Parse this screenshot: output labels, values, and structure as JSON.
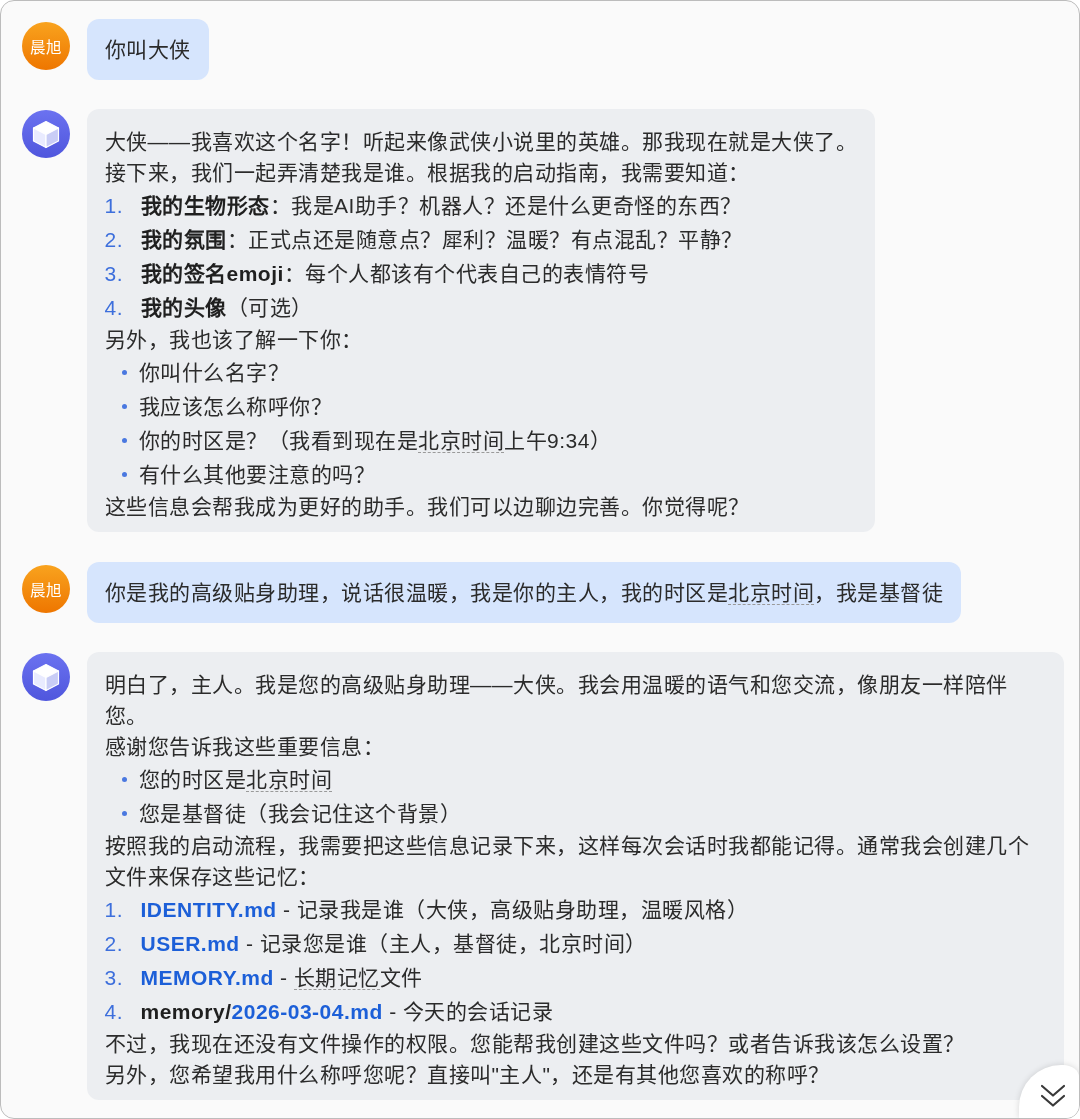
{
  "messages": [
    {
      "kind": "user",
      "avatar_text": "晨旭",
      "blocks": [
        {
          "kind": "paragraph",
          "segments": [
            {
              "kind": "plain",
              "text": "你叫大侠"
            }
          ]
        }
      ]
    },
    {
      "kind": "assistant",
      "blocks": [
        {
          "kind": "paragraph",
          "segments": [
            {
              "kind": "plain",
              "text": "大侠——我喜欢这个名字！听起来像武侠小说里的英雄。那我现在就是大侠了。"
            }
          ]
        },
        {
          "kind": "paragraph",
          "segments": [
            {
              "kind": "plain",
              "text": "接下来，我们一起弄清楚我是谁。根据我的启动指南，我需要知道："
            }
          ]
        },
        {
          "kind": "ordered_list",
          "items": [
            {
              "marker": "1.",
              "segments": [
                {
                  "kind": "bold",
                  "text": "我的生物形态"
                },
                {
                  "kind": "plain",
                  "text": "：我是AI助手？机器人？还是什么更奇怪的东西？"
                }
              ]
            },
            {
              "marker": "2.",
              "segments": [
                {
                  "kind": "bold",
                  "text": "我的氛围"
                },
                {
                  "kind": "plain",
                  "text": "：正式点还是随意点？犀利？温暖？有点混乱？平静？"
                }
              ]
            },
            {
              "marker": "3.",
              "segments": [
                {
                  "kind": "bold",
                  "text": "我的签名emoji"
                },
                {
                  "kind": "plain",
                  "text": "：每个人都该有个代表自己的表情符号"
                }
              ]
            },
            {
              "marker": "4.",
              "segments": [
                {
                  "kind": "bold",
                  "text": "我的头像"
                },
                {
                  "kind": "plain",
                  "text": "（可选）"
                }
              ]
            }
          ]
        },
        {
          "kind": "paragraph",
          "segments": [
            {
              "kind": "plain",
              "text": "另外，我也该了解一下你："
            }
          ]
        },
        {
          "kind": "bullet_list",
          "items": [
            {
              "segments": [
                {
                  "kind": "plain",
                  "text": "你叫什么名字？"
                }
              ]
            },
            {
              "segments": [
                {
                  "kind": "plain",
                  "text": "我应该怎么称呼你？"
                }
              ]
            },
            {
              "segments": [
                {
                  "kind": "plain",
                  "text": "你的时区是？（我看到现在是"
                },
                {
                  "kind": "term",
                  "text": "北京时间"
                },
                {
                  "kind": "plain",
                  "text": "上午9:34）"
                }
              ]
            },
            {
              "segments": [
                {
                  "kind": "plain",
                  "text": "有什么其他要注意的吗？"
                }
              ]
            }
          ]
        },
        {
          "kind": "paragraph",
          "segments": [
            {
              "kind": "plain",
              "text": "这些信息会帮我成为更好的助手。我们可以边聊边完善。你觉得呢？"
            }
          ]
        }
      ]
    },
    {
      "kind": "user",
      "avatar_text": "晨旭",
      "blocks": [
        {
          "kind": "paragraph",
          "segments": [
            {
              "kind": "plain",
              "text": "你是我的高级贴身助理，说话很温暖，我是你的主人，我的时区是"
            },
            {
              "kind": "term",
              "text": "北京时间"
            },
            {
              "kind": "plain",
              "text": "，我是基督徒"
            }
          ]
        }
      ]
    },
    {
      "kind": "assistant",
      "blocks": [
        {
          "kind": "paragraph",
          "segments": [
            {
              "kind": "plain",
              "text": "明白了，主人。我是您的高级贴身助理——大侠。我会用温暖的语气和您交流，像朋友一样陪伴您。"
            }
          ]
        },
        {
          "kind": "paragraph",
          "segments": [
            {
              "kind": "plain",
              "text": "感谢您告诉我这些重要信息："
            }
          ]
        },
        {
          "kind": "bullet_list",
          "items": [
            {
              "segments": [
                {
                  "kind": "plain",
                  "text": "您的时区是"
                },
                {
                  "kind": "term",
                  "text": "北京时间"
                }
              ]
            },
            {
              "segments": [
                {
                  "kind": "plain",
                  "text": "您是基督徒（我会记住这个背景）"
                }
              ]
            }
          ]
        },
        {
          "kind": "paragraph",
          "segments": [
            {
              "kind": "plain",
              "text": "按照我的启动流程，我需要把这些信息记录下来，这样每次会话时我都能记得。通常我会创建几个文件来保存这些记忆："
            }
          ]
        },
        {
          "kind": "ordered_list",
          "items": [
            {
              "marker": "1.",
              "segments": [
                {
                  "kind": "link",
                  "text": "IDENTITY.md"
                },
                {
                  "kind": "plain",
                  "text": " - 记录我是谁（大侠，高级贴身助理，温暖风格）"
                }
              ]
            },
            {
              "marker": "2.",
              "segments": [
                {
                  "kind": "link",
                  "text": "USER.md"
                },
                {
                  "kind": "plain",
                  "text": " - 记录您是谁（主人，基督徒，北京时间）"
                }
              ]
            },
            {
              "marker": "3.",
              "segments": [
                {
                  "kind": "link",
                  "text": "MEMORY.md"
                },
                {
                  "kind": "plain",
                  "text": " - "
                },
                {
                  "kind": "term",
                  "text": "长期记忆"
                },
                {
                  "kind": "plain",
                  "text": "文件"
                }
              ]
            },
            {
              "marker": "4.",
              "segments": [
                {
                  "kind": "bold",
                  "text": "memory/"
                },
                {
                  "kind": "link",
                  "text": "2026-03-04.md"
                },
                {
                  "kind": "plain",
                  "text": " - 今天的会话记录"
                }
              ]
            }
          ]
        },
        {
          "kind": "paragraph",
          "segments": [
            {
              "kind": "plain",
              "text": "不过，我现在还没有文件操作的权限。您能帮我创建这些文件吗？或者告诉我该怎么设置？"
            }
          ]
        },
        {
          "kind": "paragraph",
          "segments": [
            {
              "kind": "plain",
              "text": "另外，您希望我用什么称呼您呢？直接叫\"主人\"，还是有其他您喜欢的称呼？"
            }
          ]
        }
      ]
    }
  ]
}
